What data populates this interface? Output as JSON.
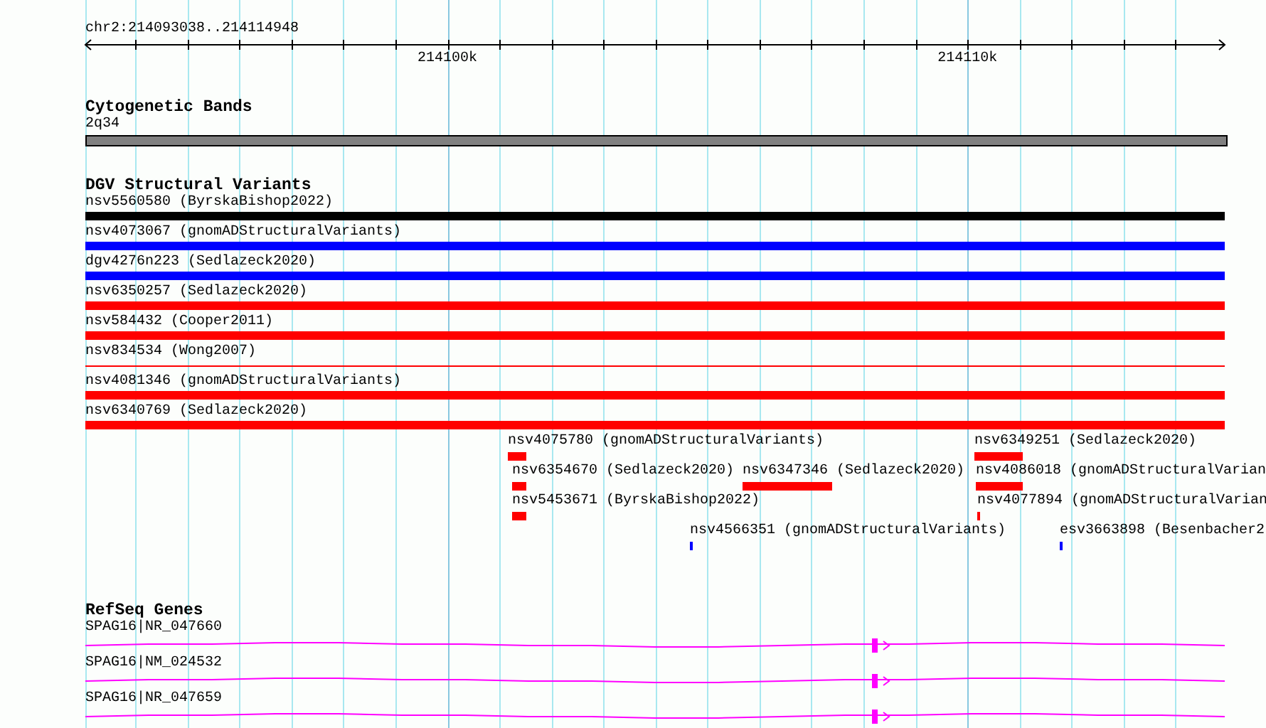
{
  "ruler": {
    "location": "chr2:214093038..214114948",
    "ticks": [
      {
        "label": "214100k"
      },
      {
        "label": "214110k"
      }
    ]
  },
  "cytogenetic_bands": {
    "title": "Cytogenetic Bands",
    "bands": [
      {
        "label": "2q34",
        "color": "#808080"
      }
    ]
  },
  "dgv_structural_variants": {
    "title": "DGV Structural Variants",
    "variants": [
      {
        "label": "nsv5560580 (ByrskaBishop2022)",
        "color": "#000000",
        "kind": "bar"
      },
      {
        "label": "nsv4073067 (gnomADStructuralVariants)",
        "color": "#0000ff",
        "kind": "bar"
      },
      {
        "label": "dgv4276n223 (Sedlazeck2020)",
        "color": "#0000ff",
        "kind": "bar"
      },
      {
        "label": "nsv6350257 (Sedlazeck2020)",
        "color": "#ff0000",
        "kind": "bar"
      },
      {
        "label": "nsv584432 (Cooper2011)",
        "color": "#ff0000",
        "kind": "bar"
      },
      {
        "label": "nsv834534 (Wong2007)",
        "color": "#ff0000",
        "kind": "line"
      },
      {
        "label": "nsv4081346 (gnomADStructuralVariants)",
        "color": "#ff0000",
        "kind": "bar"
      },
      {
        "label": "nsv6340769 (Sedlazeck2020)",
        "color": "#ff0000",
        "kind": "bar"
      }
    ],
    "lanes": [
      [
        {
          "label": "nsv4075780 (gnomADStructuralVariants)",
          "color": "#ff0000"
        },
        {
          "label": "nsv6349251 (Sedlazeck2020)",
          "color": "#ff0000"
        }
      ],
      [
        {
          "label": "nsv6354670 (Sedlazeck2020)",
          "color": "#ff0000"
        },
        {
          "label": "nsv6347346 (Sedlazeck2020)",
          "color": "#ff0000"
        },
        {
          "label": "nsv4086018 (gnomADStructuralVarian",
          "color": "#ff0000"
        }
      ],
      [
        {
          "label": "nsv5453671 (ByrskaBishop2022)",
          "color": "#ff0000"
        },
        {
          "label": "nsv4077894 (gnomADStructuralVarian",
          "color": "#ff0000"
        }
      ],
      [
        {
          "label": "nsv4566351 (gnomADStructuralVariants)",
          "color": "#0000ff"
        },
        {
          "label": "esv3663898 (Besenbacher2",
          "color": "#0000ff"
        }
      ]
    ]
  },
  "refseq_genes": {
    "title": "RefSeq Genes",
    "genes": [
      {
        "label": "SPAG16|NR_047660",
        "forward_strand": true
      },
      {
        "label": "SPAG16|NM_024532",
        "forward_strand": true
      },
      {
        "label": "SPAG16|NR_047659",
        "forward_strand": true
      }
    ]
  }
}
